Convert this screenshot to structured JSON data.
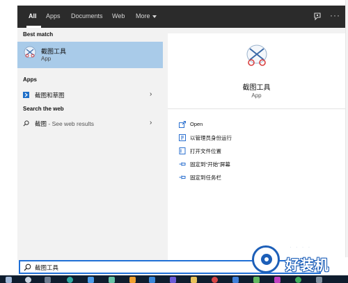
{
  "tabs": [
    {
      "label": "All"
    },
    {
      "label": "Apps"
    },
    {
      "label": "Documents"
    },
    {
      "label": "Web"
    },
    {
      "label": "More"
    }
  ],
  "top_icons": [
    "feedback-icon",
    "more-icon"
  ],
  "left": {
    "best_match_header": "Best match",
    "best_match": {
      "title": "截图工具",
      "subtitle": "App"
    },
    "apps_header": "Apps",
    "apps": [
      {
        "label": "截图和草图"
      }
    ],
    "web_header": "Search the web",
    "web": {
      "query": "截图",
      "suffix": " - See web results"
    }
  },
  "detail": {
    "title": "截图工具",
    "subtitle": "App",
    "actions": [
      {
        "label": "Open",
        "icon": "open-icon"
      },
      {
        "label": "以管理员身份运行",
        "icon": "run-as-admin-icon"
      },
      {
        "label": "打开文件位置",
        "icon": "file-location-icon"
      },
      {
        "label": "固定到\"开始\"屏幕",
        "icon": "pin-start-icon"
      },
      {
        "label": "固定到任务栏",
        "icon": "pin-taskbar-icon"
      }
    ]
  },
  "search": {
    "value": "截图工具"
  },
  "watermark": {
    "text": "好装机"
  },
  "colors": {
    "topbar": "#2b2b2b",
    "selection": "#a9cbe9",
    "accent": "#1f6fd6",
    "taskbar": "#0f1d2e"
  }
}
